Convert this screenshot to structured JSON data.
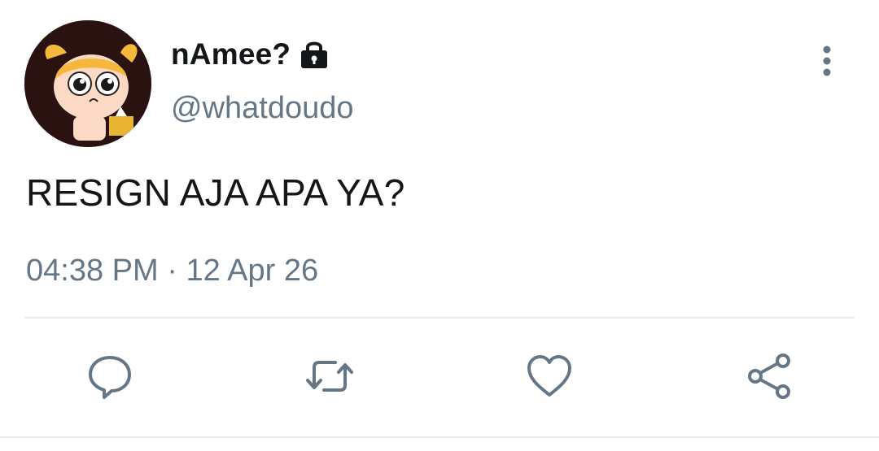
{
  "tweet": {
    "display_name": "nAmee?",
    "handle": "@whatdoudo",
    "text": "RESIGN AJA APA YA?",
    "time": "04:38 PM",
    "separator": "·",
    "date": "12 Apr 26"
  },
  "icons": {
    "lock": "lock-icon",
    "more": "more-vertical-icon",
    "reply": "reply-icon",
    "retweet": "retweet-icon",
    "like": "heart-icon",
    "share": "share-icon"
  },
  "colors": {
    "text_primary": "#14171a",
    "text_secondary": "#657786",
    "divider": "#e6ecf0"
  }
}
